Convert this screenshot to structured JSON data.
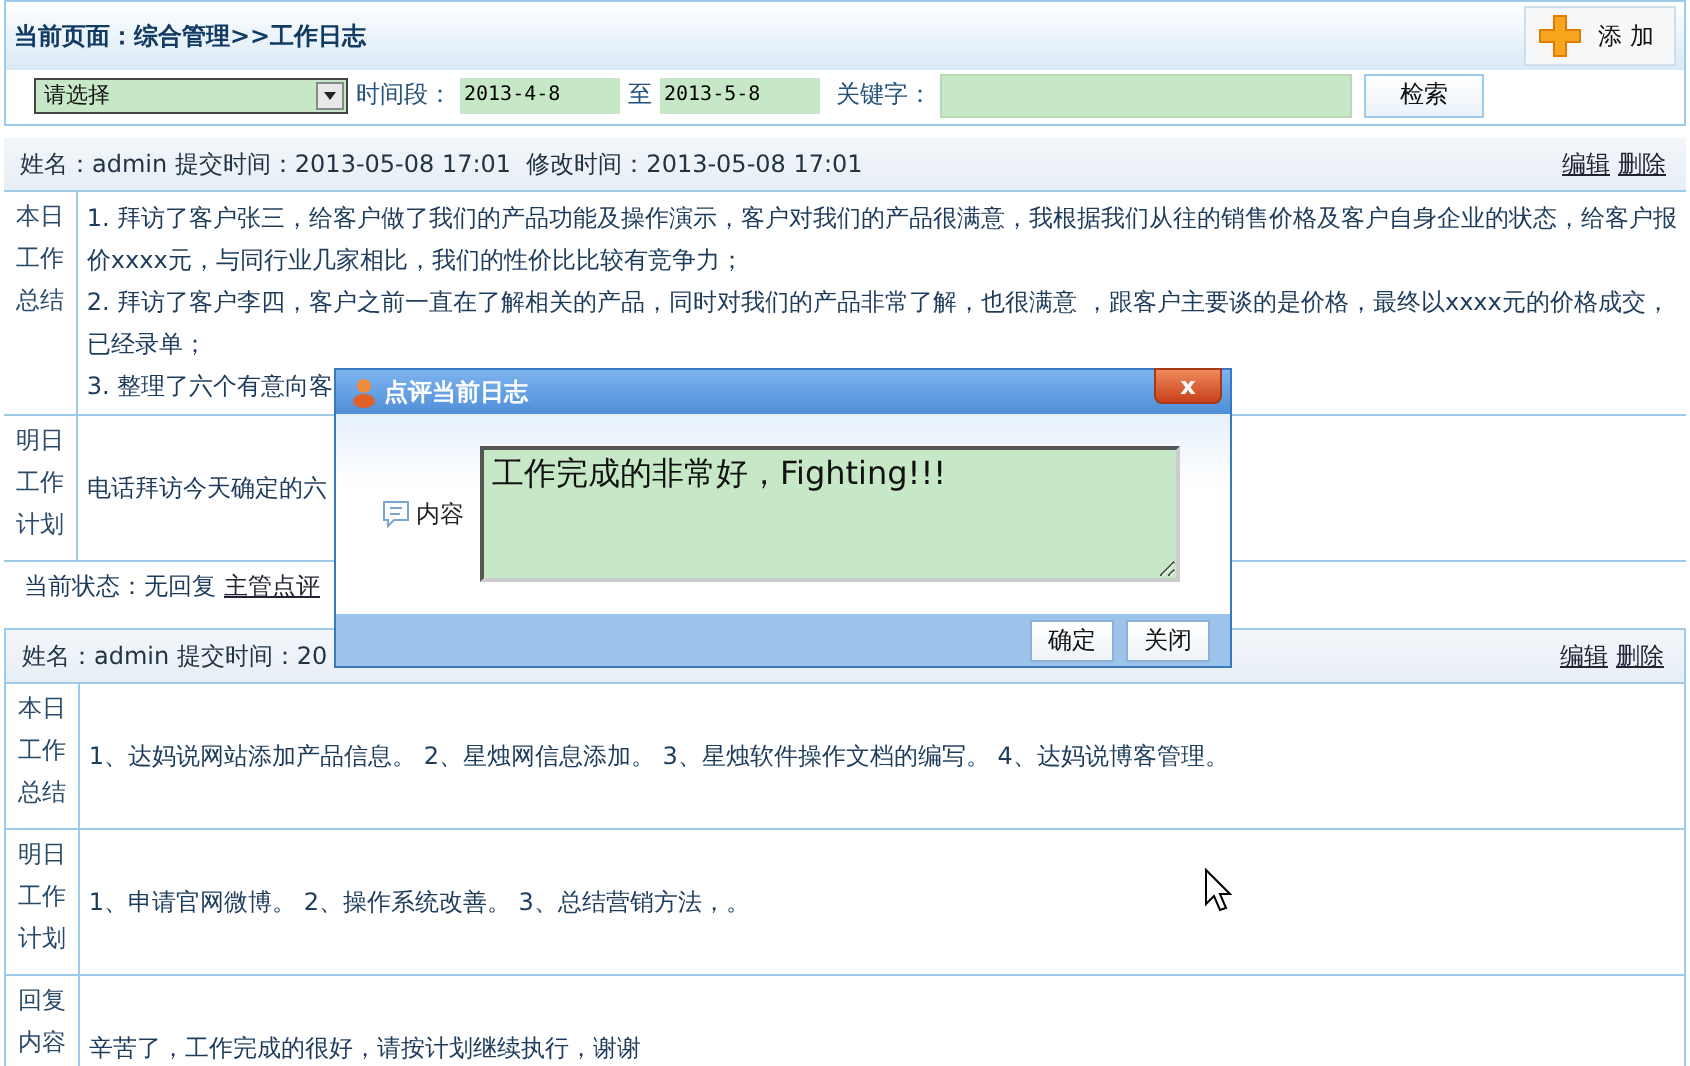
{
  "breadcrumb": "当前页面：综合管理>>工作日志",
  "add_button": "添 加",
  "filters": {
    "category": "请选择",
    "period_label": "时间段：",
    "start": "2013-4-8",
    "to_label": "至",
    "end": "2013-5-8",
    "keyword_label": "关键字：",
    "search_button": "检索"
  },
  "logs": [
    {
      "header": "姓名：admin 提交时间：2013-05-08 17:01  修改时间：2013-05-08 17:01",
      "actions": [
        "编辑",
        "删除"
      ],
      "rows": [
        {
          "label": "本日工作总结",
          "lines": [
            "1. 拜访了客户张三，给客户做了我们的产品功能及操作演示，客户对我们的产品很满意，我根据我们从往的销售价格及客户自身企业的状态，给客户报价xxxx元，与同行业几家相比，我们的性价比比较有竞争力；",
            "2. 拜访了客户李四，客户之前一直在了解相关的产品，同时对我们的产品非常了解，也很满意 ，跟客户主要谈的是价格，最终以xxxx元的价格成交，已经录单；",
            "3. 整理了六个有意向客"
          ]
        },
        {
          "label": "明日工作计划",
          "lines": [
            "电话拜访今天确定的六"
          ]
        }
      ],
      "status": {
        "text": "当前状态：无回复",
        "link": "主管点评"
      }
    },
    {
      "header": "姓名：admin 提交时间：20",
      "actions": [
        "编辑",
        "删除"
      ],
      "rows": [
        {
          "label": "本日工作总结",
          "lines": [
            "1、达妈说网站添加产品信息。 2、星烛网信息添加。 3、星烛软件操作文档的编写。 4、达妈说博客管理。"
          ]
        },
        {
          "label": "明日工作计划",
          "lines": [
            "1、申请官网微博。 2、操作系统改善。 3、总结营销方法，。"
          ]
        },
        {
          "label": "回复内容",
          "lines": [
            "辛苦了，工作完成的很好，请按计划继续执行，谢谢"
          ]
        }
      ]
    }
  ],
  "dialog": {
    "title": "点评当前日志",
    "close": "x",
    "field_label": "内容",
    "value": "工作完成的非常好，Fighting!!!",
    "buttons": [
      "确定",
      "关闭"
    ]
  }
}
